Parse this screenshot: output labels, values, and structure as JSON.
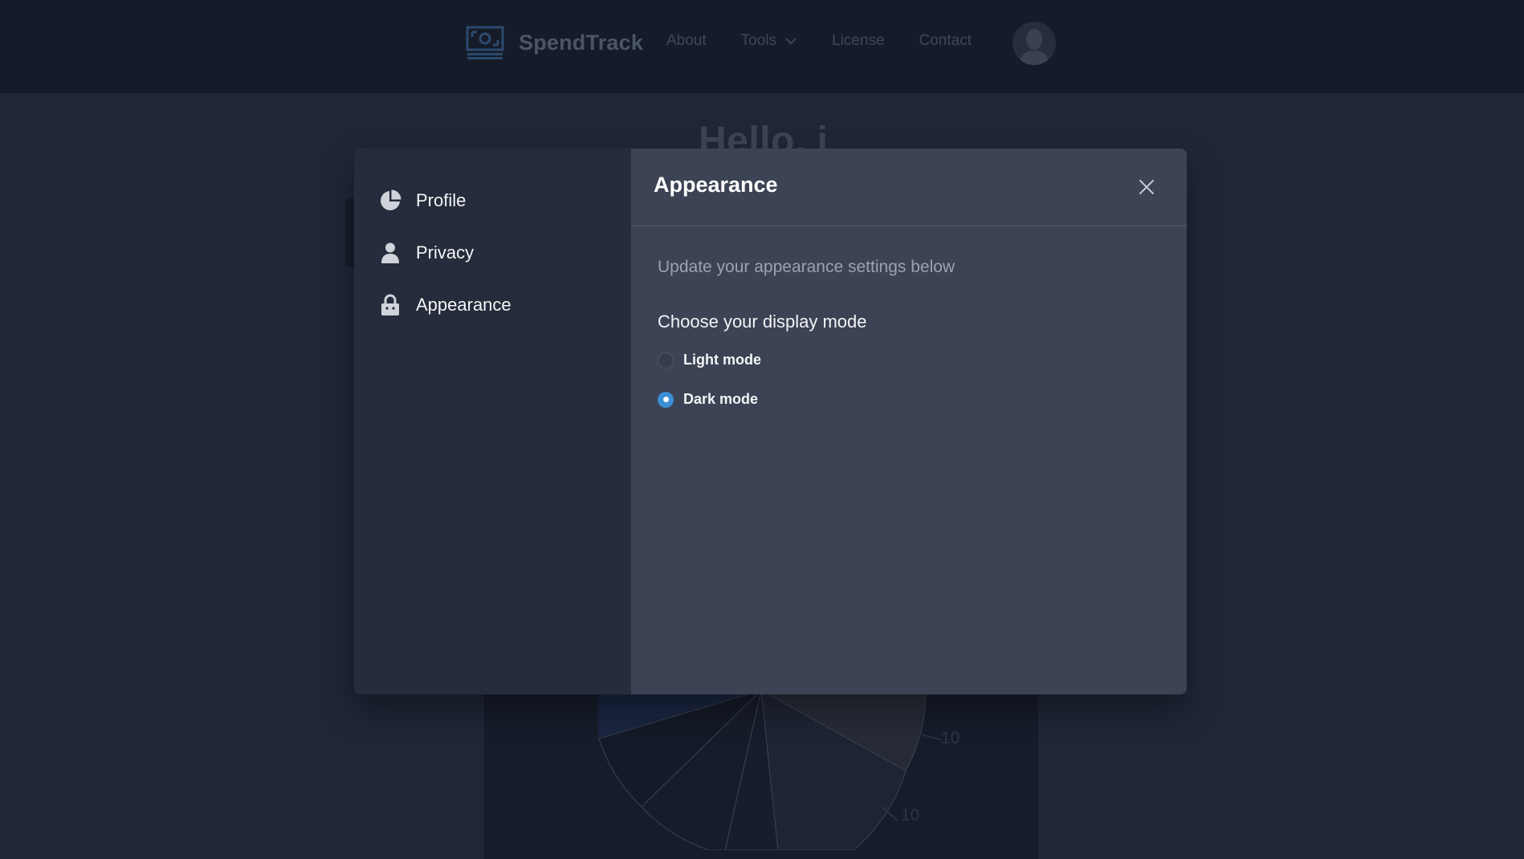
{
  "header": {
    "brand": "SpendTrack",
    "nav": [
      {
        "label": "About"
      },
      {
        "label": "Tools"
      },
      {
        "label": "License"
      },
      {
        "label": "Contact"
      }
    ]
  },
  "background": {
    "greeting": "Hello, j",
    "pie_labels": [
      "10",
      "10"
    ]
  },
  "modal": {
    "sidebar": [
      {
        "label": "Profile",
        "icon": "pie-chart-icon"
      },
      {
        "label": "Privacy",
        "icon": "user-icon"
      },
      {
        "label": "Appearance",
        "icon": "lock-icon"
      }
    ],
    "title": "Appearance",
    "subtitle": "Update your appearance settings below",
    "section_label": "Choose your display mode",
    "options": [
      {
        "label": "Light mode",
        "checked": false
      },
      {
        "label": "Dark mode",
        "checked": true
      }
    ]
  },
  "colors": {
    "accent": "#3b8fd6",
    "modal_panel": "#3b4354",
    "modal_sidebar": "#252c3b",
    "backdrop": "#1f2637"
  }
}
